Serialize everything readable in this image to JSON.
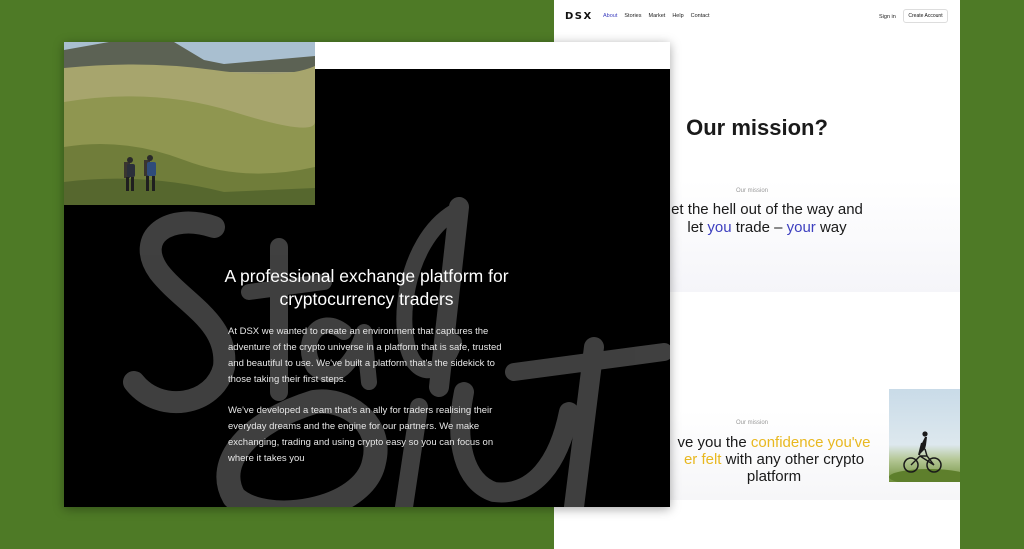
{
  "right_page": {
    "nav": {
      "logo": "DSX",
      "links": [
        "About",
        "Stories",
        "Market",
        "Help",
        "Contact"
      ],
      "sign_in": "Sign in",
      "create_account": "Create Account"
    },
    "title": "Our mission?",
    "section_1": {
      "label": "Our mission",
      "text_a": "et the hell out of the way and",
      "text_b": "let ",
      "text_c": "you",
      "text_d": " trade – ",
      "text_e": "your",
      "text_f": " way"
    },
    "section_2": {
      "label": "Our mission",
      "text_a": "ve you the ",
      "text_b": "confidence you've",
      "text_c": "er felt",
      "text_d": " with any other crypto",
      "text_e": "platform"
    }
  },
  "left_card": {
    "heading": "A professional exchange platform for cryptocurrency traders",
    "paragraph_1": "At DSX we wanted to create an environment that captures the adventure of the crypto universe in a platform that is safe, trusted and beautiful to use. We've built a platform that's the sidekick to those taking their first steps.",
    "paragraph_2": "We've developed a team that's an ally for traders realising their everyday dreams and the engine for our partners. We make exchanging, trading and using crypto easy so you can focus on where it takes you"
  },
  "colors": {
    "background_green": "#4e7a26",
    "accent_blue": "#3d3fbf",
    "accent_yellow": "#e8b820"
  }
}
